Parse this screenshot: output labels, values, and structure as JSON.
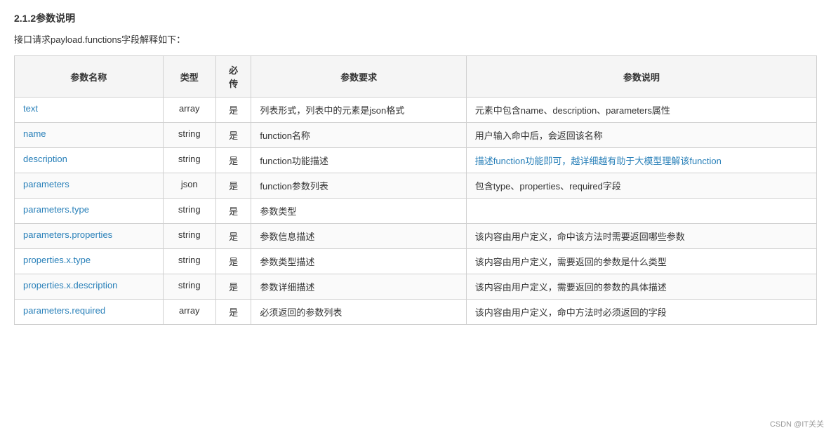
{
  "section": {
    "title": "2.1.2参数说明",
    "intro": "接口请求payload.functions字段解释如下："
  },
  "table": {
    "headers": [
      "参数名称",
      "类型",
      "必\n传",
      "参数要求",
      "参数说明"
    ],
    "rows": [
      {
        "name": "text",
        "type": "array",
        "required": "是",
        "requirement": "列表形式，列表中的元素是json格式",
        "description": "元素中包含name、description、parameters属性"
      },
      {
        "name": "name",
        "type": "string",
        "required": "是",
        "requirement": "function名称",
        "description": "用户输入命中后，会返回该名称"
      },
      {
        "name": "description",
        "type": "string",
        "required": "是",
        "requirement": "function功能描述",
        "description": "描述function功能即可，越详细越有助于大模型理解该function"
      },
      {
        "name": "parameters",
        "type": "json",
        "required": "是",
        "requirement": "function参数列表",
        "description": "包含type、properties、required字段"
      },
      {
        "name": "parameters.type",
        "type": "string",
        "required": "是",
        "requirement": "参数类型",
        "description": ""
      },
      {
        "name": "parameters.properties",
        "type": "string",
        "required": "是",
        "requirement": "参数信息描述",
        "description": "该内容由用户定义，命中该方法时需要返回哪些参数"
      },
      {
        "name": "properties.x.type",
        "type": "string",
        "required": "是",
        "requirement": "参数类型描述",
        "description": "该内容由用户定义，需要返回的参数是什么类型"
      },
      {
        "name": "properties.x.description",
        "type": "string",
        "required": "是",
        "requirement": "参数详细描述",
        "description": "该内容由用户定义，需要返回的参数的具体描述"
      },
      {
        "name": "parameters.required",
        "type": "array",
        "required": "是",
        "requirement": "必须返回的参数列表",
        "description": "该内容由用户定义，命中方法时必须返回的字段"
      }
    ]
  },
  "watermark": "CSDN @IT关关"
}
